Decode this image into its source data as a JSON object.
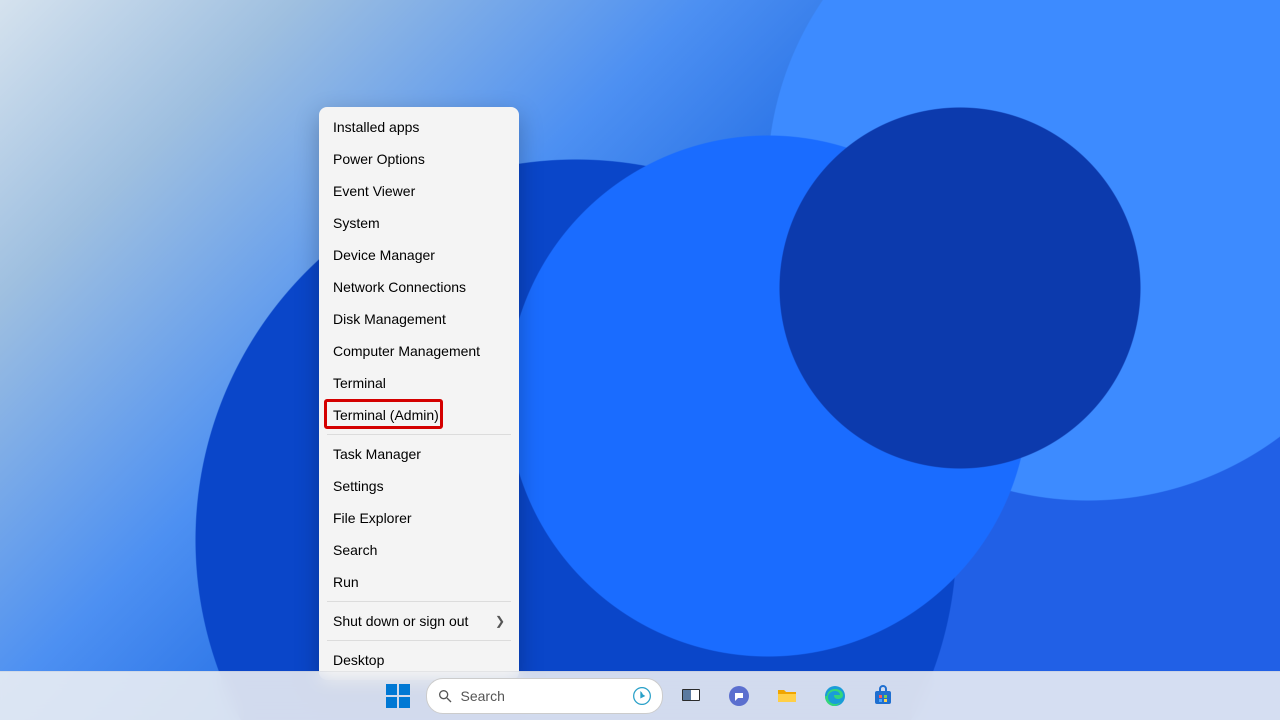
{
  "context_menu": {
    "items": [
      {
        "label": "Installed apps"
      },
      {
        "label": "Power Options"
      },
      {
        "label": "Event Viewer"
      },
      {
        "label": "System"
      },
      {
        "label": "Device Manager"
      },
      {
        "label": "Network Connections"
      },
      {
        "label": "Disk Management"
      },
      {
        "label": "Computer Management"
      },
      {
        "label": "Terminal"
      },
      {
        "label": "Terminal (Admin)"
      },
      {
        "label": "Task Manager"
      },
      {
        "label": "Settings"
      },
      {
        "label": "File Explorer"
      },
      {
        "label": "Search"
      },
      {
        "label": "Run"
      },
      {
        "label": "Shut down or sign out",
        "submenu": true
      },
      {
        "label": "Desktop"
      }
    ],
    "highlighted_index": 9
  },
  "taskbar": {
    "search_placeholder": "Search"
  }
}
